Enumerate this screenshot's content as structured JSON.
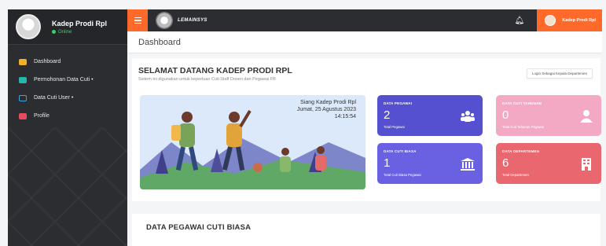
{
  "sidebar": {
    "user_name": "Kadep Prodi Rpl",
    "status": "Online",
    "items": [
      {
        "label": "Dashboard"
      },
      {
        "label": "Permohonan Data Cuti •"
      },
      {
        "label": "Data Cuti User •"
      },
      {
        "label": "Profile"
      }
    ]
  },
  "topbar": {
    "brand": "LEMAINSYS",
    "user_name": "Kadep Prodi Rpl"
  },
  "breadcrumb": {
    "title": "Dashboard"
  },
  "welcome": {
    "title": "SELAMAT DATANG KADEP PRODI RPL",
    "subtitle": "Sistem ini digunakan untuk keperluan Cuti Staff Dosen dan Pegawai FB",
    "action_label": "Login Sebagai Kepala Departemen",
    "greeting": "Siang Kadep Prodi Rpl",
    "date": "Jumat, 25 Agustus 2023",
    "time": "14:15:54"
  },
  "stats": [
    {
      "title": "DATA PEGAWAI",
      "value": "2",
      "label": "Total Pegawai",
      "icon": "users-icon",
      "color": "#5450cf"
    },
    {
      "title": "DATA CUTI TAHUNAN",
      "value": "0",
      "label": "Total Cuti Tahunan Pegawai",
      "icon": "user-icon",
      "color": "#f3a8c4"
    },
    {
      "title": "DATA CUTI BIASA",
      "value": "1",
      "label": "Total Cuti Biasa Pegawai",
      "icon": "bank-icon",
      "color": "#6a60e2"
    },
    {
      "title": "DATA DEPARTEMEN",
      "value": "6",
      "label": "Total Departemen",
      "icon": "building-icon",
      "color": "#e9676f"
    }
  ],
  "section": {
    "title": "DATA PEGAWAI CUTI BIASA"
  }
}
